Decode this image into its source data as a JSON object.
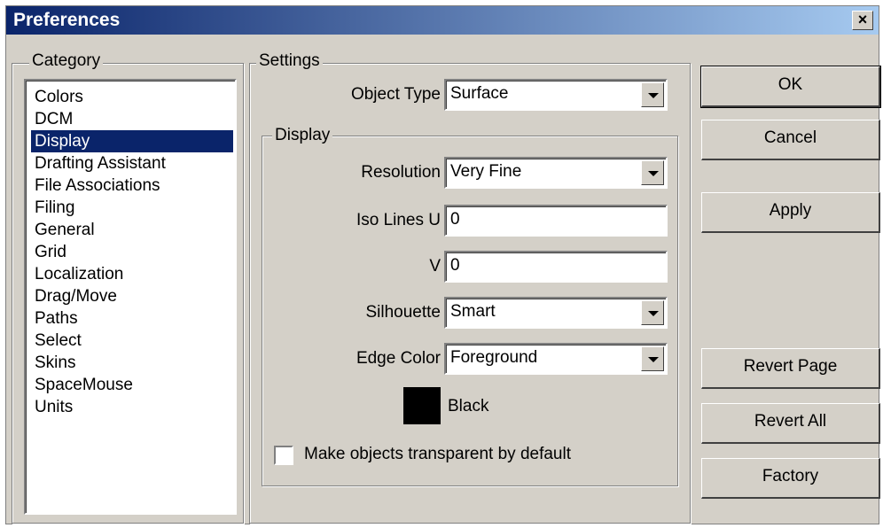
{
  "window": {
    "title": "Preferences",
    "close_label": "×"
  },
  "category": {
    "legend": "Category",
    "items": [
      "Colors",
      "DCM",
      "Display",
      "Drafting Assistant",
      "File Associations",
      "Filing",
      "General",
      "Grid",
      "Localization",
      "Drag/Move",
      "Paths",
      "Select",
      "Skins",
      "SpaceMouse",
      "Units"
    ],
    "selected": "Display"
  },
  "settings": {
    "legend": "Settings",
    "object_type_label": "Object Type",
    "object_type_value": "Surface",
    "display": {
      "legend": "Display",
      "resolution_label": "Resolution",
      "resolution_value": "Very Fine",
      "iso_u_label": "Iso Lines U",
      "iso_u_value": "0",
      "iso_v_label": "V",
      "iso_v_value": "0",
      "silhouette_label": "Silhouette",
      "silhouette_value": "Smart",
      "edge_color_label": "Edge Color",
      "edge_color_value": "Foreground",
      "color_name": "Black",
      "color_swatch": "#000000",
      "transparent_label": "Make objects transparent by default",
      "transparent_checked": false
    }
  },
  "buttons": {
    "ok": "OK",
    "cancel": "Cancel",
    "apply": "Apply",
    "revert_page": "Revert Page",
    "revert_all": "Revert All",
    "factory": "Factory"
  }
}
